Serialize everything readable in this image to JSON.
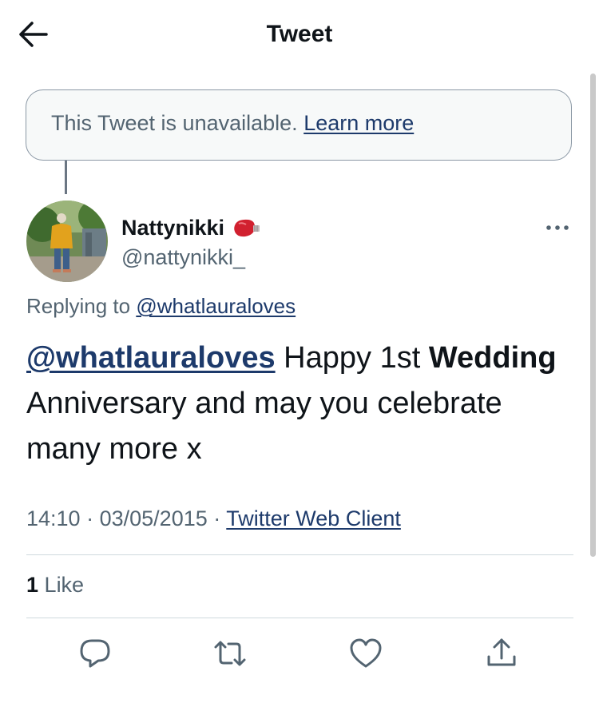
{
  "header": {
    "title": "Tweet",
    "back_icon": "arrow-left-icon"
  },
  "unavailable": {
    "text": "This Tweet is unavailable.",
    "link": "Learn more"
  },
  "tweet": {
    "display_name": "Nattynikki",
    "name_emoji": "boxing-glove-icon",
    "handle": "@nattynikki_",
    "replying_prefix": "Replying to",
    "replying_to": "@whatlauraloves",
    "text_mention": "@whatlauraloves",
    "text_part1": " Happy 1st ",
    "text_bold": "Wedding",
    "text_part2": " Anniversary and may you celebrate many more x",
    "time": "14:10",
    "separator1": "·",
    "date": "03/05/2015",
    "separator2": "·",
    "source": "Twitter Web Client",
    "like_count": "1",
    "like_label": "Like"
  },
  "actions": [
    "reply-icon",
    "retweet-icon",
    "like-icon",
    "share-icon"
  ],
  "colors": {
    "link": "#1d3a6b",
    "muted": "#536471",
    "text": "#0f1419",
    "border": "#cfd9de"
  }
}
